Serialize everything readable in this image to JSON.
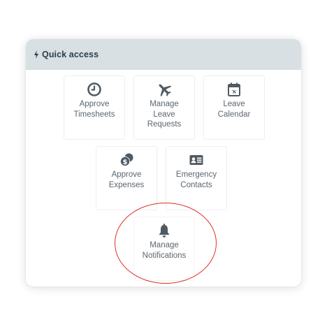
{
  "quick_access": {
    "title": "Quick access",
    "header_icon": "bolt-icon",
    "tiles": [
      {
        "label": "Approve\nTimesheets",
        "icon": "clock-icon"
      },
      {
        "label": "Manage\nLeave\nRequests",
        "icon": "airplane-icon"
      },
      {
        "label": "Leave\nCalendar",
        "icon": "calendar-plane-icon"
      },
      {
        "label": "Approve\nExpenses",
        "icon": "coins-icon"
      },
      {
        "label": "Emergency\nContacts",
        "icon": "id-card-icon"
      },
      {
        "label": "Manage\nNotifications",
        "icon": "bell-icon"
      }
    ]
  },
  "colors": {
    "header_bg": "#d8e0e4",
    "icon": "#4f5a63",
    "text": "#5c6670",
    "highlight": "#e0302b"
  }
}
